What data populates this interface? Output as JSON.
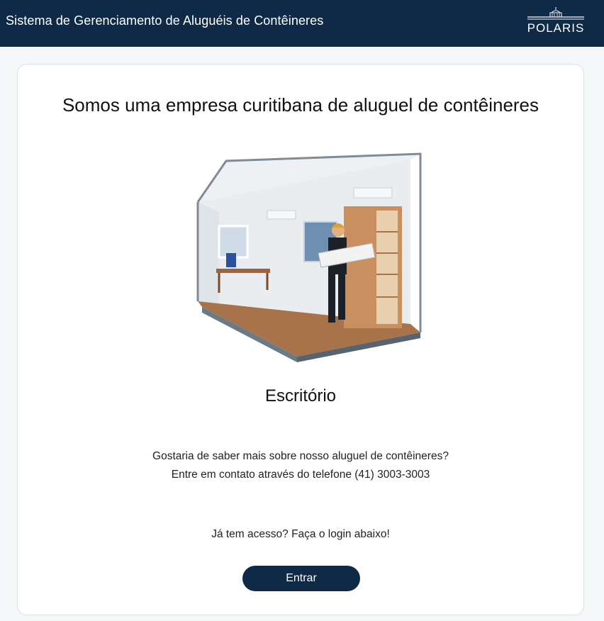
{
  "header": {
    "title": "Sistema de Gerenciamento de Aluguéis de Contêineres",
    "logo_text": "POLARIS",
    "logo_icon": "capitol-building-icon"
  },
  "main": {
    "headline": "Somos uma empresa curitibana de aluguel de contêineres",
    "illustration": "office-container-illustration",
    "product_name": "Escritório",
    "info_line1": "Gostaria de saber mais sobre nosso aluguel de contêineres?",
    "info_line2": "Entre em contato através do telefone (41) 3003-3003",
    "login_prompt": "Já tem acesso? Faça o login abaixo!",
    "login_button": "Entrar"
  },
  "colors": {
    "header_bg": "#0f2a47",
    "button_bg": "#0f2a47",
    "page_bg": "#f3f7f8",
    "card_bg": "#ffffff"
  }
}
